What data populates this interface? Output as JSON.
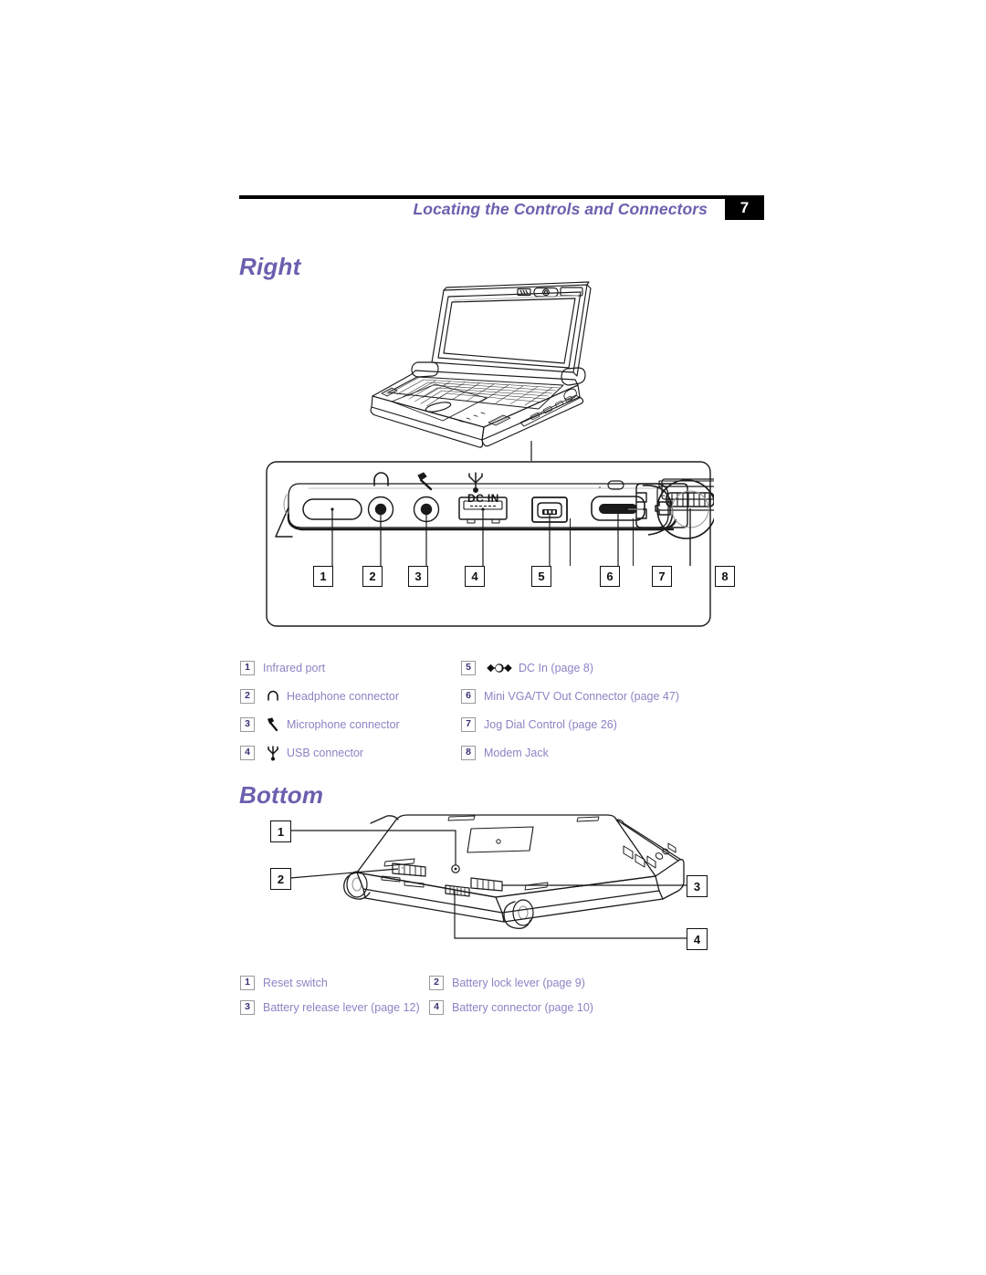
{
  "header": {
    "title": "Locating the Controls and Connectors",
    "page_number": "7"
  },
  "sections": {
    "right": {
      "heading": "Right"
    },
    "bottom": {
      "heading": "Bottom"
    }
  },
  "right_diagram": {
    "dc_in_label": "DC IN",
    "callouts": [
      "1",
      "2",
      "3",
      "4",
      "5",
      "6",
      "7",
      "8"
    ]
  },
  "bottom_diagram": {
    "callouts": [
      "1",
      "2",
      "3",
      "4"
    ]
  },
  "right_legend": {
    "column1": [
      {
        "num": "1",
        "icon": "none",
        "label": "Infrared port"
      },
      {
        "num": "2",
        "icon": "headphone-icon",
        "label": "Headphone connector"
      },
      {
        "num": "3",
        "icon": "microphone-icon",
        "label": "Microphone connector"
      },
      {
        "num": "4",
        "icon": "usb-icon",
        "label": "USB connector"
      }
    ],
    "column2": [
      {
        "num": "5",
        "icon": "dc-in-icon",
        "label": "DC In (page 8)"
      },
      {
        "num": "6",
        "icon": "none",
        "label": "Mini VGA/TV Out Connector (page 47)"
      },
      {
        "num": "7",
        "icon": "none",
        "label": "Jog Dial Control (page 26)"
      },
      {
        "num": "8",
        "icon": "none",
        "label": "Modem Jack"
      }
    ]
  },
  "bottom_legend": {
    "column1": [
      {
        "num": "1",
        "label": "Reset switch"
      },
      {
        "num": "3",
        "label": "Battery release lever (page 12)"
      }
    ],
    "column2": [
      {
        "num": "2",
        "label": "Battery lock lever (page 9)"
      },
      {
        "num": "4",
        "label": "Battery connector (page 10)"
      }
    ]
  },
  "colors": {
    "accent_purple": "#6b5fae",
    "legend_text": "#8d83c4",
    "legend_num": "#3b3173",
    "rule_black": "#000000"
  }
}
